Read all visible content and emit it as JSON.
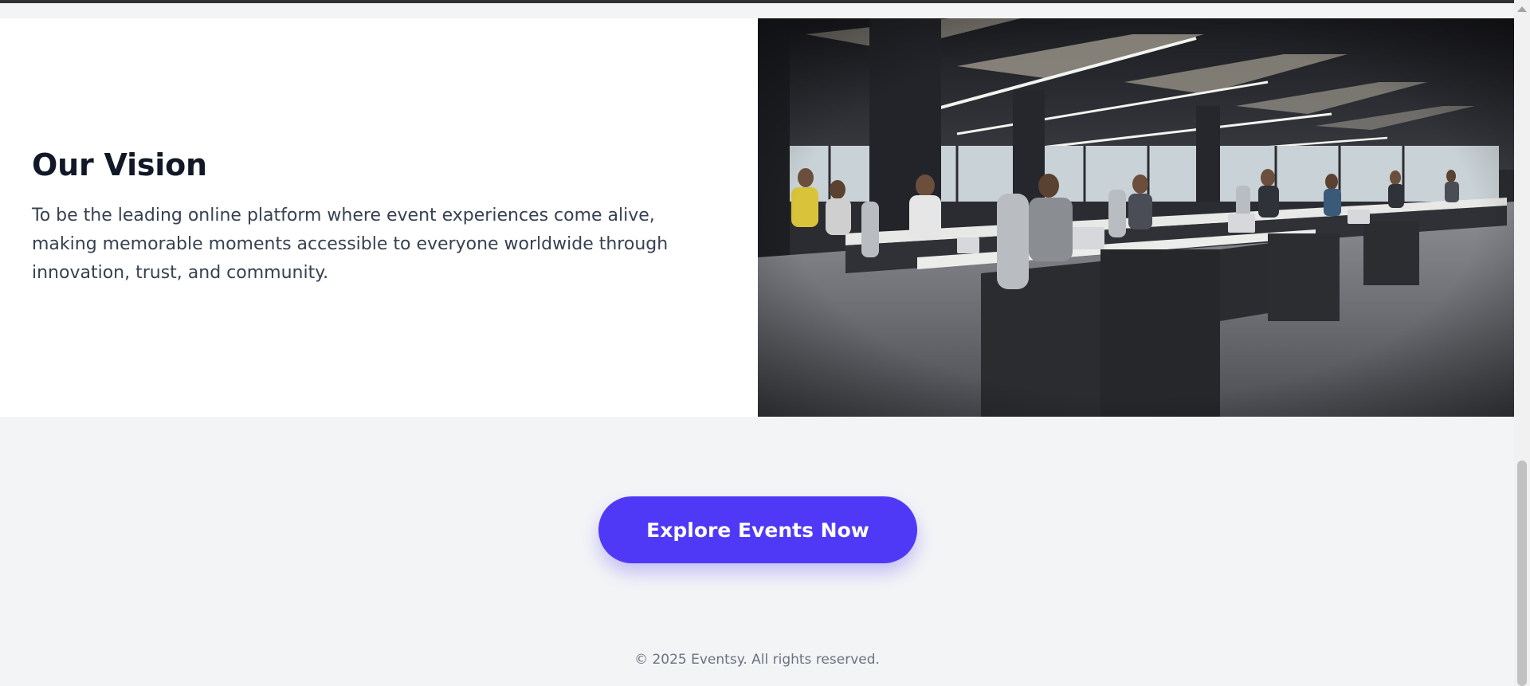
{
  "vision": {
    "title": "Our Vision",
    "body": "To be the leading online platform where event experiences come alive, making memorable moments accessible to everyone worldwide through innovation, trust, and community.",
    "image_subject": "Open-plan office with rows of people working at laptops"
  },
  "cta": {
    "label": "Explore Events Now",
    "color": "#4f39f6"
  },
  "footer": {
    "copyright": "© 2025 Eventsy. All rights reserved."
  },
  "colors": {
    "page_bg": "#f3f4f6",
    "section_bg": "#ffffff",
    "heading": "#111827",
    "body_text": "#374151",
    "footer_text": "#6b7280"
  }
}
